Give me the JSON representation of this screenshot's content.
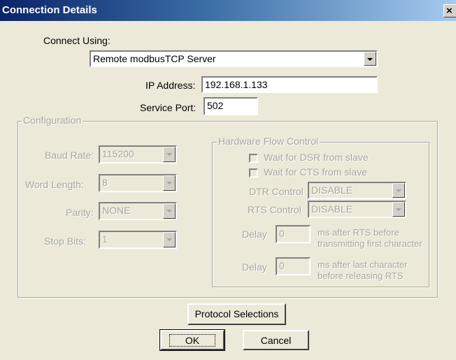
{
  "window": {
    "title": "Connection Details",
    "close_glyph": "×"
  },
  "connect": {
    "label": "Connect Using:",
    "value": "Remote modbusTCP Server"
  },
  "ip": {
    "label": "IP Address:",
    "value": "192.168.1.133"
  },
  "port": {
    "label": "Service Port:",
    "value": "502"
  },
  "config": {
    "legend": "Configuration",
    "baud": {
      "label": "Baud Rate:",
      "value": "115200"
    },
    "word": {
      "label": "Word Length:",
      "value": "8"
    },
    "parity": {
      "label": "Parity:",
      "value": "NONE"
    },
    "stop": {
      "label": "Stop Bits:",
      "value": "1"
    }
  },
  "hw": {
    "legend": "Hardware Flow Control",
    "dsr": "Wait for DSR from slave",
    "cts": "Wait for CTS from slave",
    "dtr": {
      "label": "DTR Control",
      "value": "DISABLE"
    },
    "rts": {
      "label": "RTS Control",
      "value": "DISABLE"
    },
    "delay1": {
      "label": "Delay",
      "value": "0",
      "desc1": "ms after RTS before",
      "desc2": "transmitting first character"
    },
    "delay2": {
      "label": "Delay",
      "value": "0",
      "desc1": "ms after last character",
      "desc2": "before releasing RTS"
    }
  },
  "buttons": {
    "protocol": "Protocol Selections",
    "ok": "OK",
    "cancel": "Cancel"
  }
}
